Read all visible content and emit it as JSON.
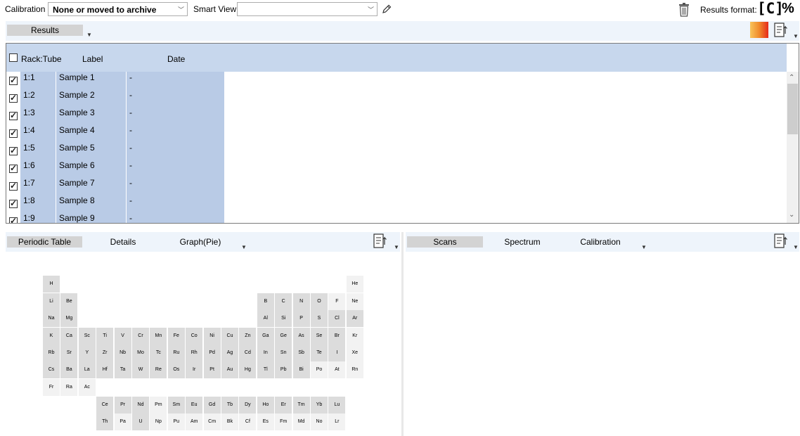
{
  "toolbar": {
    "calibration_label": "Calibration",
    "calibration_value": "None or moved to archive",
    "smart_view_label": "Smart View",
    "smart_view_value": "",
    "results_format_label": "Results format:",
    "format_concentration": "[C]",
    "format_percent": "%"
  },
  "results_tabs": {
    "results": "Results"
  },
  "grid": {
    "columns": [
      "Rack:Tube",
      "Label",
      "Date"
    ],
    "rows": [
      {
        "rack": "1:1",
        "label": "Sample 1",
        "date": "-"
      },
      {
        "rack": "1:2",
        "label": "Sample 2",
        "date": "-"
      },
      {
        "rack": "1:3",
        "label": "Sample 3",
        "date": "-"
      },
      {
        "rack": "1:4",
        "label": "Sample 4",
        "date": "-"
      },
      {
        "rack": "1:5",
        "label": "Sample 5",
        "date": "-"
      },
      {
        "rack": "1:6",
        "label": "Sample 6",
        "date": "-"
      },
      {
        "rack": "1:7",
        "label": "Sample 7",
        "date": "-"
      },
      {
        "rack": "1:8",
        "label": "Sample 8",
        "date": "-"
      },
      {
        "rack": "1:9",
        "label": "Sample 9",
        "date": "-"
      }
    ]
  },
  "left_tabs": {
    "periodic_table": "Periodic Table",
    "details": "Details",
    "graph_pie": "Graph(Pie)"
  },
  "right_tabs": {
    "scans": "Scans",
    "spectrum": "Spectrum",
    "calibration": "Calibration"
  },
  "colors": {
    "header_bg": "#c7d7ed",
    "cell_bg": "#b9cbe6",
    "strip_bg": "#eef4fb",
    "tab_active": "#d3d3d3",
    "element_gray": "#dcdcdc",
    "element_light": "#f2f2f2"
  },
  "elements": [
    {
      "s": "H",
      "r": 0,
      "c": 0,
      "t": "g"
    },
    {
      "s": "He",
      "r": 0,
      "c": 17,
      "t": "l"
    },
    {
      "s": "Li",
      "r": 1,
      "c": 0,
      "t": "g"
    },
    {
      "s": "Be",
      "r": 1,
      "c": 1,
      "t": "g"
    },
    {
      "s": "B",
      "r": 1,
      "c": 12,
      "t": "g"
    },
    {
      "s": "C",
      "r": 1,
      "c": 13,
      "t": "g"
    },
    {
      "s": "N",
      "r": 1,
      "c": 14,
      "t": "g"
    },
    {
      "s": "O",
      "r": 1,
      "c": 15,
      "t": "g"
    },
    {
      "s": "F",
      "r": 1,
      "c": 16,
      "t": "l"
    },
    {
      "s": "Ne",
      "r": 1,
      "c": 17,
      "t": "l"
    },
    {
      "s": "Na",
      "r": 2,
      "c": 0,
      "t": "g"
    },
    {
      "s": "Mg",
      "r": 2,
      "c": 1,
      "t": "g"
    },
    {
      "s": "Al",
      "r": 2,
      "c": 12,
      "t": "g"
    },
    {
      "s": "Si",
      "r": 2,
      "c": 13,
      "t": "g"
    },
    {
      "s": "P",
      "r": 2,
      "c": 14,
      "t": "g"
    },
    {
      "s": "S",
      "r": 2,
      "c": 15,
      "t": "g"
    },
    {
      "s": "Cl",
      "r": 2,
      "c": 16,
      "t": "g"
    },
    {
      "s": "Ar",
      "r": 2,
      "c": 17,
      "t": "g"
    },
    {
      "s": "K",
      "r": 3,
      "c": 0,
      "t": "g"
    },
    {
      "s": "Ca",
      "r": 3,
      "c": 1,
      "t": "g"
    },
    {
      "s": "Sc",
      "r": 3,
      "c": 2,
      "t": "g"
    },
    {
      "s": "Ti",
      "r": 3,
      "c": 3,
      "t": "g"
    },
    {
      "s": "V",
      "r": 3,
      "c": 4,
      "t": "g"
    },
    {
      "s": "Cr",
      "r": 3,
      "c": 5,
      "t": "g"
    },
    {
      "s": "Mn",
      "r": 3,
      "c": 6,
      "t": "g"
    },
    {
      "s": "Fe",
      "r": 3,
      "c": 7,
      "t": "g"
    },
    {
      "s": "Co",
      "r": 3,
      "c": 8,
      "t": "g"
    },
    {
      "s": "Ni",
      "r": 3,
      "c": 9,
      "t": "g"
    },
    {
      "s": "Cu",
      "r": 3,
      "c": 10,
      "t": "g"
    },
    {
      "s": "Zn",
      "r": 3,
      "c": 11,
      "t": "g"
    },
    {
      "s": "Ga",
      "r": 3,
      "c": 12,
      "t": "g"
    },
    {
      "s": "Ge",
      "r": 3,
      "c": 13,
      "t": "g"
    },
    {
      "s": "As",
      "r": 3,
      "c": 14,
      "t": "g"
    },
    {
      "s": "Se",
      "r": 3,
      "c": 15,
      "t": "g"
    },
    {
      "s": "Br",
      "r": 3,
      "c": 16,
      "t": "g"
    },
    {
      "s": "Kr",
      "r": 3,
      "c": 17,
      "t": "l"
    },
    {
      "s": "Rb",
      "r": 4,
      "c": 0,
      "t": "g"
    },
    {
      "s": "Sr",
      "r": 4,
      "c": 1,
      "t": "g"
    },
    {
      "s": "Y",
      "r": 4,
      "c": 2,
      "t": "g"
    },
    {
      "s": "Zr",
      "r": 4,
      "c": 3,
      "t": "g"
    },
    {
      "s": "Nb",
      "r": 4,
      "c": 4,
      "t": "g"
    },
    {
      "s": "Mo",
      "r": 4,
      "c": 5,
      "t": "g"
    },
    {
      "s": "Tc",
      "r": 4,
      "c": 6,
      "t": "g"
    },
    {
      "s": "Ru",
      "r": 4,
      "c": 7,
      "t": "g"
    },
    {
      "s": "Rh",
      "r": 4,
      "c": 8,
      "t": "g"
    },
    {
      "s": "Pd",
      "r": 4,
      "c": 9,
      "t": "g"
    },
    {
      "s": "Ag",
      "r": 4,
      "c": 10,
      "t": "g"
    },
    {
      "s": "Cd",
      "r": 4,
      "c": 11,
      "t": "g"
    },
    {
      "s": "In",
      "r": 4,
      "c": 12,
      "t": "g"
    },
    {
      "s": "Sn",
      "r": 4,
      "c": 13,
      "t": "g"
    },
    {
      "s": "Sb",
      "r": 4,
      "c": 14,
      "t": "g"
    },
    {
      "s": "Te",
      "r": 4,
      "c": 15,
      "t": "g"
    },
    {
      "s": "I",
      "r": 4,
      "c": 16,
      "t": "g"
    },
    {
      "s": "Xe",
      "r": 4,
      "c": 17,
      "t": "l"
    },
    {
      "s": "Cs",
      "r": 5,
      "c": 0,
      "t": "g"
    },
    {
      "s": "Ba",
      "r": 5,
      "c": 1,
      "t": "g"
    },
    {
      "s": "La",
      "r": 5,
      "c": 2,
      "t": "g"
    },
    {
      "s": "Hf",
      "r": 5,
      "c": 3,
      "t": "g"
    },
    {
      "s": "Ta",
      "r": 5,
      "c": 4,
      "t": "g"
    },
    {
      "s": "W",
      "r": 5,
      "c": 5,
      "t": "g"
    },
    {
      "s": "Re",
      "r": 5,
      "c": 6,
      "t": "g"
    },
    {
      "s": "Os",
      "r": 5,
      "c": 7,
      "t": "g"
    },
    {
      "s": "Ir",
      "r": 5,
      "c": 8,
      "t": "g"
    },
    {
      "s": "Pt",
      "r": 5,
      "c": 9,
      "t": "g"
    },
    {
      "s": "Au",
      "r": 5,
      "c": 10,
      "t": "g"
    },
    {
      "s": "Hg",
      "r": 5,
      "c": 11,
      "t": "g"
    },
    {
      "s": "Tl",
      "r": 5,
      "c": 12,
      "t": "g"
    },
    {
      "s": "Pb",
      "r": 5,
      "c": 13,
      "t": "g"
    },
    {
      "s": "Bi",
      "r": 5,
      "c": 14,
      "t": "g"
    },
    {
      "s": "Po",
      "r": 5,
      "c": 15,
      "t": "l"
    },
    {
      "s": "At",
      "r": 5,
      "c": 16,
      "t": "l"
    },
    {
      "s": "Rn",
      "r": 5,
      "c": 17,
      "t": "l"
    },
    {
      "s": "Fr",
      "r": 6,
      "c": 0,
      "t": "l"
    },
    {
      "s": "Ra",
      "r": 6,
      "c": 1,
      "t": "l"
    },
    {
      "s": "Ac",
      "r": 6,
      "c": 2,
      "t": "l"
    },
    {
      "s": "Ce",
      "r": 7,
      "c": 3,
      "t": "g"
    },
    {
      "s": "Pr",
      "r": 7,
      "c": 4,
      "t": "g"
    },
    {
      "s": "Nd",
      "r": 7,
      "c": 5,
      "t": "g"
    },
    {
      "s": "Pm",
      "r": 7,
      "c": 6,
      "t": "l"
    },
    {
      "s": "Sm",
      "r": 7,
      "c": 7,
      "t": "g"
    },
    {
      "s": "Eu",
      "r": 7,
      "c": 8,
      "t": "g"
    },
    {
      "s": "Gd",
      "r": 7,
      "c": 9,
      "t": "g"
    },
    {
      "s": "Tb",
      "r": 7,
      "c": 10,
      "t": "g"
    },
    {
      "s": "Dy",
      "r": 7,
      "c": 11,
      "t": "g"
    },
    {
      "s": "Ho",
      "r": 7,
      "c": 12,
      "t": "g"
    },
    {
      "s": "Er",
      "r": 7,
      "c": 13,
      "t": "g"
    },
    {
      "s": "Tm",
      "r": 7,
      "c": 14,
      "t": "g"
    },
    {
      "s": "Yb",
      "r": 7,
      "c": 15,
      "t": "g"
    },
    {
      "s": "Lu",
      "r": 7,
      "c": 16,
      "t": "g"
    },
    {
      "s": "Th",
      "r": 8,
      "c": 3,
      "t": "g"
    },
    {
      "s": "Pa",
      "r": 8,
      "c": 4,
      "t": "l"
    },
    {
      "s": "U",
      "r": 8,
      "c": 5,
      "t": "g"
    },
    {
      "s": "Np",
      "r": 8,
      "c": 6,
      "t": "l"
    },
    {
      "s": "Pu",
      "r": 8,
      "c": 7,
      "t": "l"
    },
    {
      "s": "Am",
      "r": 8,
      "c": 8,
      "t": "l"
    },
    {
      "s": "Cm",
      "r": 8,
      "c": 9,
      "t": "l"
    },
    {
      "s": "Bk",
      "r": 8,
      "c": 10,
      "t": "l"
    },
    {
      "s": "Cf",
      "r": 8,
      "c": 11,
      "t": "l"
    },
    {
      "s": "Es",
      "r": 8,
      "c": 12,
      "t": "l"
    },
    {
      "s": "Fm",
      "r": 8,
      "c": 13,
      "t": "l"
    },
    {
      "s": "Md",
      "r": 8,
      "c": 14,
      "t": "l"
    },
    {
      "s": "No",
      "r": 8,
      "c": 15,
      "t": "l"
    },
    {
      "s": "Lr",
      "r": 8,
      "c": 16,
      "t": "l"
    }
  ]
}
